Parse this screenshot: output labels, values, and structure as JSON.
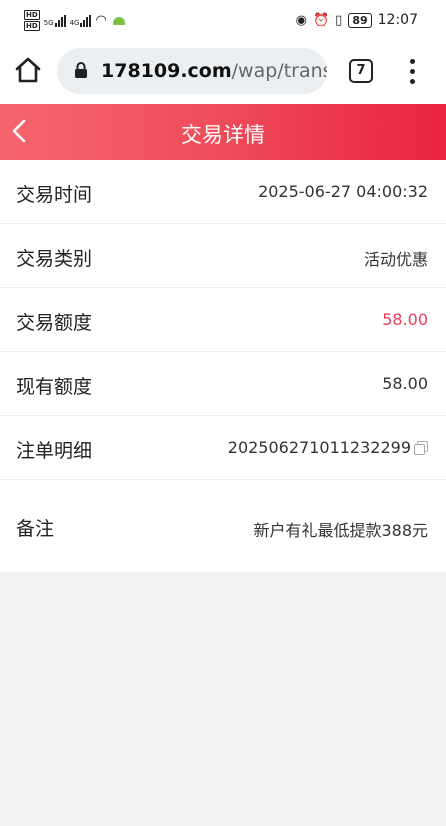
{
  "status_bar": {
    "time": "12:07",
    "battery": "89",
    "network": "5G",
    "network2": "4G"
  },
  "browser": {
    "url_domain": "178109.com",
    "url_path": "/wap/transa",
    "tab_count": "7"
  },
  "header": {
    "title": "交易详情"
  },
  "rows": [
    {
      "label": "交易时间",
      "value": "2025-06-27 04:00:32"
    },
    {
      "label": "交易类别",
      "value": "活动优惠"
    },
    {
      "label": "交易额度",
      "value": "58.00"
    },
    {
      "label": "现有额度",
      "value": "58.00"
    },
    {
      "label": "注单明细",
      "value": "202506271011232299"
    },
    {
      "label": "备注",
      "value": "新户有礼最低提款388元"
    }
  ],
  "colors": {
    "header_start": "#f7656e",
    "header_end": "#e8243c",
    "amount_red": "#e8405a"
  }
}
